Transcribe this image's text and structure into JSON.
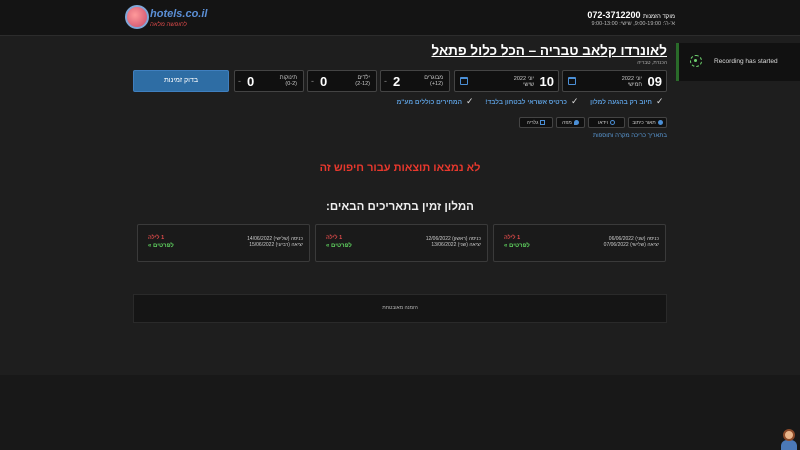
{
  "header": {
    "logo_text": "hotels.co.il",
    "logo_slogan": "לחופשה מלאה",
    "phone": "072-3712200",
    "phone_label": "מוקד הזמנות",
    "hours": "א'-ה': 9:00-19:00, שישי: 9:00-13:00"
  },
  "hotel": {
    "title": "לאונרדו קלאב טבריה – הכל כלול פתאל",
    "breadcrumb": "הכנרת, טבריה"
  },
  "toast": {
    "text": "Recording has started"
  },
  "search": {
    "checkin": {
      "day": "09",
      "month": "יוני 2022",
      "weekday": "חמישי"
    },
    "checkout": {
      "day": "10",
      "month": "יוני 2022",
      "weekday": "שישי"
    },
    "adults": {
      "value": "2",
      "label": "מבוגרים",
      "sub": "(12+)"
    },
    "children": {
      "value": "0",
      "label": "ילדים",
      "sub": "(2-12)"
    },
    "infants": {
      "value": "0",
      "label": "תינוקות",
      "sub": "(0-2)"
    },
    "button": "בדוק זמינות"
  },
  "features": [
    "חיוב רק בהגעה למלון",
    "כרטיס אשראי לבטחון בלבד!",
    "המחירים כוללים מע\"מ"
  ],
  "tabs": {
    "description": "תאור כיתוב",
    "video": "וידאו",
    "map": "מפה",
    "gallery": "גלריה"
  },
  "compare_link": "בתאריך כריכה מקרה ותוספות",
  "no_results": "לא נמצאו תוצאות עבור חיפוש זה",
  "available_title": "המלון זמין בתאריכים הבאים:",
  "cards": [
    {
      "in": "כניסה (שני) 06/06/2022",
      "out": "יציאה (שלישי) 07/06/2022",
      "nights": "1 לילה",
      "link": "לפרטים »"
    },
    {
      "in": "כניסה (ראשון) 12/06/2022",
      "out": "יציאה (שני) 13/06/2022",
      "nights": "1 לילה",
      "link": "לפרטים »"
    },
    {
      "in": "כניסה (שלישי) 14/06/2022",
      "out": "יציאה (רביעי) 15/06/2022",
      "nights": "1 לילה",
      "link": "לפרטים »"
    }
  ],
  "ad_text": "הזמנה מאובטחת",
  "colors": {
    "accent": "#2e6da4",
    "error": "#e8382d",
    "link": "#5b9bd8",
    "success": "#5fd35f"
  }
}
